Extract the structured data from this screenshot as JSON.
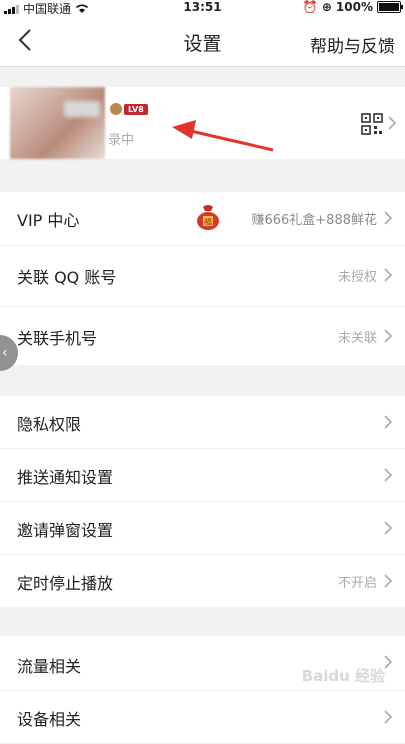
{
  "status_bar": {
    "carrier": "中国联通",
    "time": "13:51",
    "battery": "100%"
  },
  "nav": {
    "title": "设置",
    "help": "帮助与反馈"
  },
  "profile": {
    "level": "LV8",
    "login_status": "录中"
  },
  "groups": [
    {
      "rows": [
        {
          "label": "VIP 中心",
          "value": "赚666礼盒+888鲜花",
          "icon": "lucky-bag-icon",
          "badge_text": "福"
        },
        {
          "label": "关联 QQ 账号",
          "value": "未授权"
        },
        {
          "label": "关联手机号",
          "value": "未关联"
        }
      ]
    },
    {
      "rows": [
        {
          "label": "隐私权限",
          "value": ""
        },
        {
          "label": "推送通知设置",
          "value": ""
        },
        {
          "label": "邀请弹窗设置",
          "value": ""
        },
        {
          "label": "定时停止播放",
          "value": "不开启"
        }
      ]
    },
    {
      "rows": [
        {
          "label": "流量相关",
          "value": ""
        },
        {
          "label": "设备相关",
          "value": ""
        }
      ]
    }
  ],
  "watermark": "Baidu 经验",
  "colors": {
    "accent": "#e2342b",
    "background": "#f2f2f2"
  }
}
